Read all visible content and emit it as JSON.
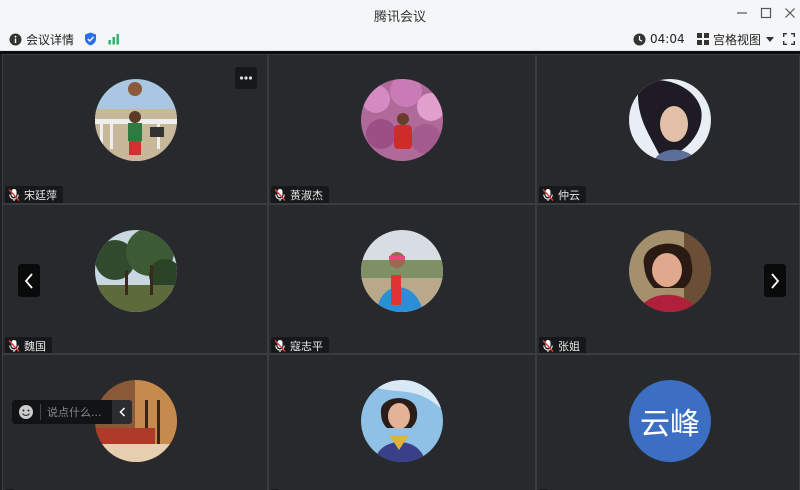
{
  "window": {
    "title": "腾讯会议",
    "minimize_icon": "minimize-icon",
    "maximize_icon": "maximize-icon",
    "close_icon": "close-icon"
  },
  "toolbar": {
    "meeting_info_label": "会议详情",
    "timer": "04:04",
    "view_mode_label": "宫格视图",
    "icons": [
      "info-icon",
      "shield-icon",
      "signal-icon",
      "clock-icon",
      "grid-icon",
      "chevron-down-icon",
      "fullscreen-icon"
    ]
  },
  "participants": [
    {
      "name": "宋廷萍",
      "avatar_type": "photo"
    },
    {
      "name": "蒉淑杰",
      "avatar_type": "photo"
    },
    {
      "name": "仲云",
      "avatar_type": "photo"
    },
    {
      "name": "魏国",
      "avatar_type": "photo"
    },
    {
      "name": "寇志平",
      "avatar_type": "photo"
    },
    {
      "name": "张姐",
      "avatar_type": "photo"
    },
    {
      "name": "",
      "avatar_type": "photo"
    },
    {
      "name": "",
      "avatar_type": "photo"
    },
    {
      "name": "",
      "avatar_type": "text",
      "avatar_text": "云峰"
    }
  ],
  "chat": {
    "placeholder": "说点什么..."
  },
  "colors": {
    "tile_bg": "#27292c",
    "text_avatar_bg": "#3c6fc4",
    "shield": "#2b6fe8",
    "signal": "#27b36a"
  }
}
